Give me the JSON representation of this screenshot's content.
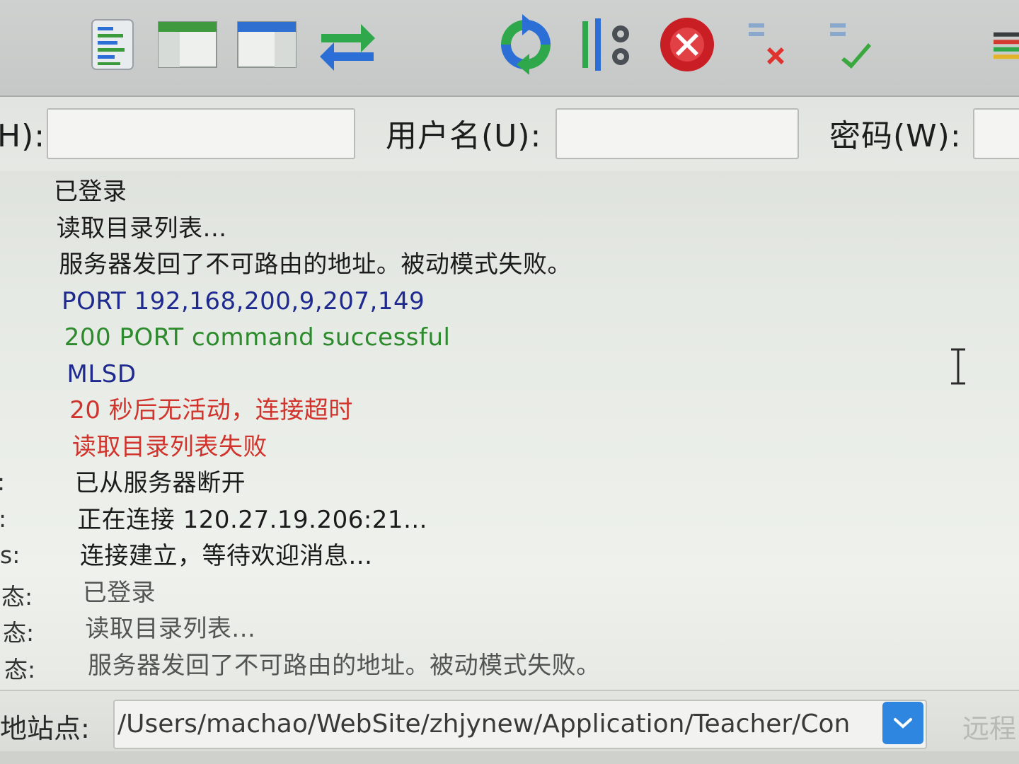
{
  "toolbar": {
    "buttons": [
      {
        "name": "message-log-icon"
      },
      {
        "name": "local-tree-icon"
      },
      {
        "name": "remote-tree-icon"
      },
      {
        "name": "transfer-queue-icon"
      },
      {
        "name": "refresh-icon"
      },
      {
        "name": "process-queue-icon"
      },
      {
        "name": "cancel-operation-icon"
      },
      {
        "name": "disconnect-icon"
      },
      {
        "name": "reconnect-icon"
      },
      {
        "name": "directory-filter-icon"
      }
    ]
  },
  "quickconnect": {
    "host_label": "H):",
    "username_label": "用户名(U):",
    "password_label": "密码(W):",
    "host_value": "",
    "username_value": "",
    "password_value": ""
  },
  "log": {
    "rows": [
      {
        "label": "",
        "text": "已登录",
        "kind": "status"
      },
      {
        "label": "",
        "text": "读取目录列表...",
        "kind": "status"
      },
      {
        "label": "",
        "text": "服务器发回了不可路由的地址。被动模式失败。",
        "kind": "status"
      },
      {
        "label": "",
        "text": "PORT 192,168,200,9,207,149",
        "kind": "command"
      },
      {
        "label": "",
        "text": "200 PORT command successful",
        "kind": "response"
      },
      {
        "label": "",
        "text": "MLSD",
        "kind": "command"
      },
      {
        "label": "",
        "text": "20 秒后无活动，连接超时",
        "kind": "error"
      },
      {
        "label": "",
        "text": "读取目录列表失败",
        "kind": "error"
      },
      {
        "label": ":",
        "text": "已从服务器断开",
        "kind": "status"
      },
      {
        "label": ":",
        "text": "正在连接 120.27.19.206:21...",
        "kind": "status"
      },
      {
        "label": "s:",
        "text": "连接建立，等待欢迎消息...",
        "kind": "status"
      },
      {
        "label": "态:",
        "text": "已登录",
        "kind": "status"
      },
      {
        "label": "态:",
        "text": "读取目录列表...",
        "kind": "status"
      },
      {
        "label": "态:",
        "text": "服务器发回了不可路由的地址。被动模式失败。",
        "kind": "status"
      }
    ]
  },
  "localsite": {
    "label": "地站点:",
    "path": "/Users/machao/WebSite/zhjynew/Application/Teacher/Con",
    "remote_label": "远程"
  },
  "colors": {
    "status": "#1b1b1b",
    "command": "#1e2a8f",
    "response": "#2d8a2d",
    "error": "#d0342c",
    "accent": "#2f86e0"
  }
}
